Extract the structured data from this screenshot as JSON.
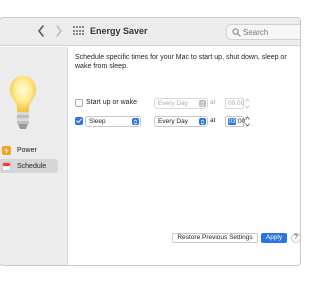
{
  "window": {
    "title": "Energy Saver",
    "search_placeholder": "Search"
  },
  "sidebar": {
    "items": [
      {
        "label": "Power",
        "icon": "bolt-icon"
      },
      {
        "label": "Schedule",
        "icon": "calendar-icon",
        "selected": true
      }
    ]
  },
  "main": {
    "description": "Schedule specific times for your Mac to start up, shut down, sleep or wake from sleep.",
    "rows": [
      {
        "checked": false,
        "label": "Start up or wake",
        "day": "Every Day",
        "at": "at",
        "time": "00:00",
        "enabled": false
      },
      {
        "checked": true,
        "action": "Sleep",
        "day": "Every Day",
        "at": "at",
        "time_hour": "03",
        "time_min": ":00",
        "enabled": true
      }
    ],
    "buttons": {
      "restore": "Restore Previous Settings",
      "apply": "Apply",
      "help": "?"
    }
  },
  "colors": {
    "accent": "#2c74e6",
    "power_icon": "#f6a21d",
    "window_chrome": "#ececec"
  }
}
